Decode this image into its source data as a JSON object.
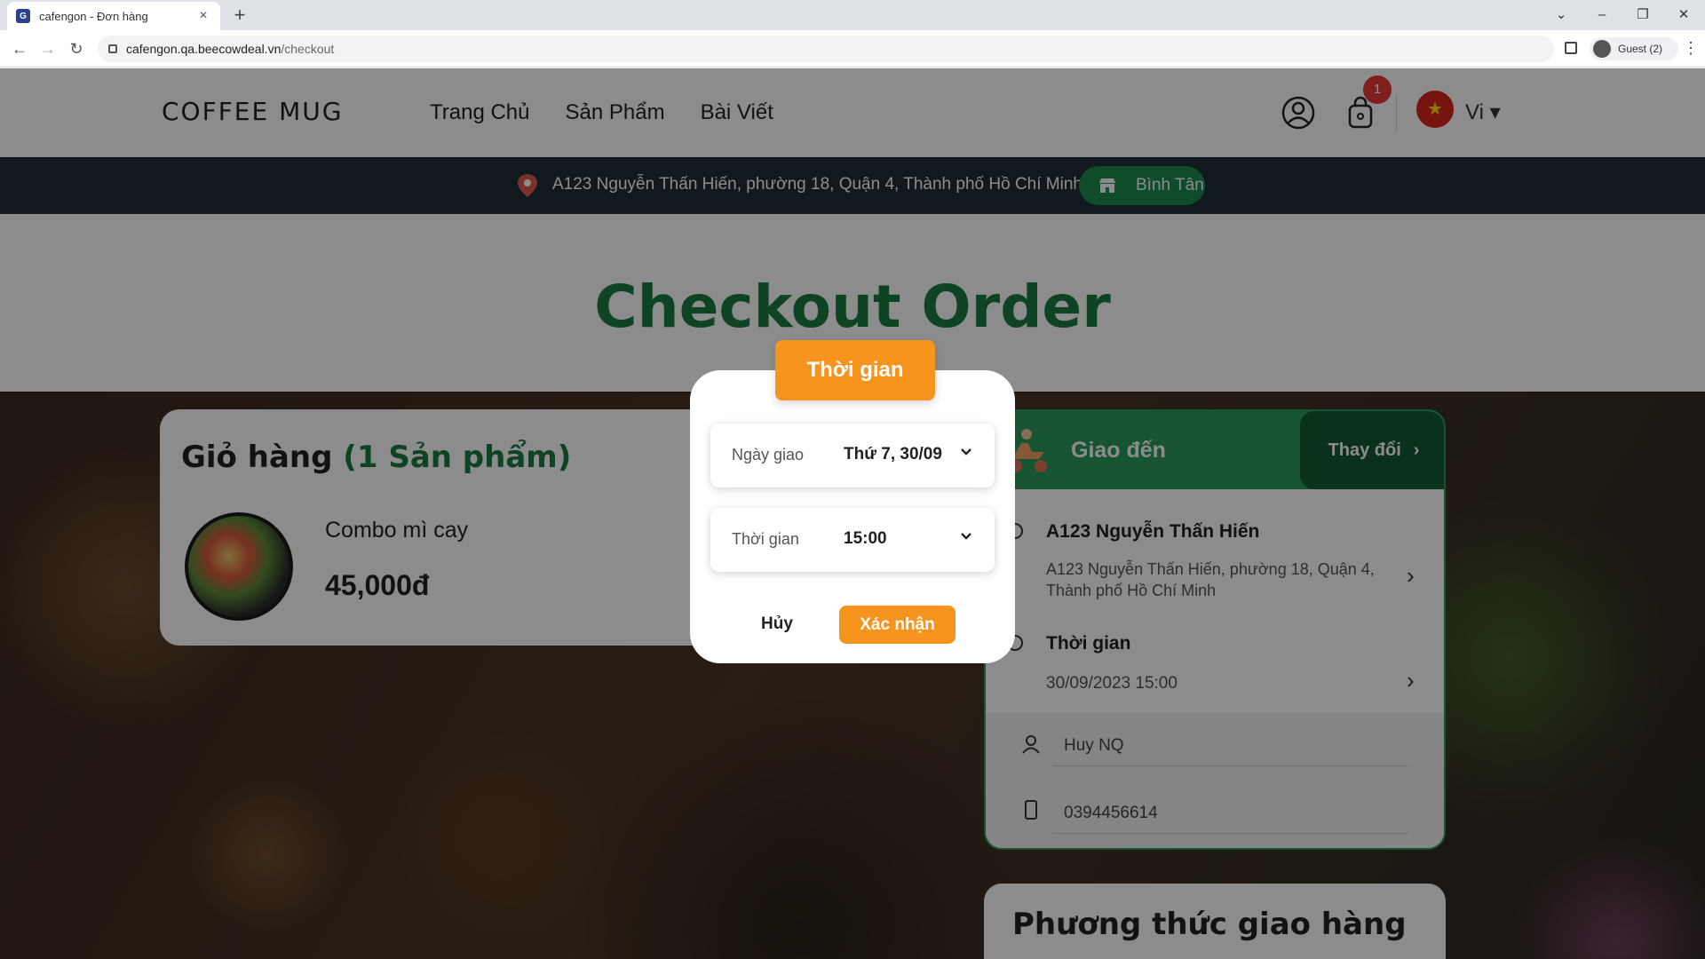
{
  "browser": {
    "tab_title": "cafengon - Đơn hàng",
    "tab_close": "×",
    "new_tab": "+",
    "url_host": "cafengon.qa.beecowdeal.vn",
    "url_path": "/checkout",
    "profile_label": "Guest (2)",
    "menu": "⋮"
  },
  "site": {
    "logo": "COFFEE MUG",
    "nav": [
      "Trang Chủ",
      "Sản Phẩm",
      "Bài Viết"
    ],
    "cart_badge": "1",
    "language": "Vi ▾",
    "address": "A123 Nguyễn Thấn Hiến, phường 18, Quận 4, Thành phố Hồ Chí Minh",
    "branch": "Bình Tân",
    "page_title": "Checkout Order"
  },
  "cart": {
    "title": "Giỏ hàng",
    "count": "(1 Sản phẩm)",
    "item_name": "Combo mì cay",
    "item_price": "45,000đ"
  },
  "delivery": {
    "header": "Giao đến",
    "change_label": "Thay đổi",
    "address_title": "A123 Nguyễn Thấn Hiến",
    "address_text": "A123 Nguyễn Thấn Hiến, phường 18, Quận 4, Thành phố Hồ Chí Minh",
    "time_title": "Thời gian",
    "time_value": "30/09/2023 15:00",
    "name_value": "Huy NQ",
    "phone_value": "0394456614"
  },
  "shipping": {
    "title": "Phương thức giao hàng"
  },
  "modal": {
    "title": "Thời gian",
    "date_label": "Ngày giao",
    "date_value": "Thứ 7, 30/09",
    "time_label": "Thời gian",
    "time_value": "15:00",
    "cancel": "Hủy",
    "confirm": "Xác nhận"
  },
  "colors": {
    "brand_green": "#1b7a43",
    "accent_orange": "#f7941d",
    "badge_red": "#e53935",
    "address_bar": "#1f2c38"
  }
}
